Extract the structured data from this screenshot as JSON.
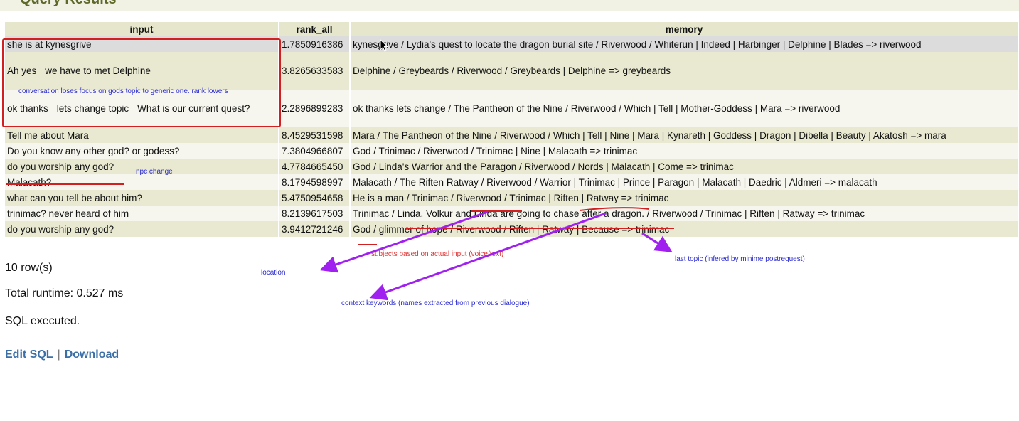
{
  "page": {
    "section_title": "Query Results"
  },
  "table": {
    "columns": [
      "input",
      "rank_all",
      "memory"
    ],
    "rows": [
      {
        "input_a": "she is at kynesgrive",
        "input_b": "",
        "input_c": "",
        "rank_all": "1.7850916386",
        "memory": "kynesgrive / Lydia's quest to locate the dragon burial site / Riverwood / Whiterun | Indeed | Harbinger | Delphine | Blades => riverwood"
      },
      {
        "input_a": "Ah yes",
        "input_b": "we have to met Delphine",
        "input_c": "",
        "rank_all": "3.8265633583",
        "memory": "Delphine / Greybeards / Riverwood / Greybeards | Delphine => greybeards"
      },
      {
        "input_a": "ok  thanks",
        "input_b": "lets change topic",
        "input_c": "What is our current quest?",
        "rank_all": "2.2896899283",
        "memory": "ok thanks lets change / The Pantheon of the Nine / Riverwood / Which | Tell | Mother-Goddess | Mara => riverwood"
      },
      {
        "input_a": "Tell me about Mara",
        "input_b": "",
        "input_c": "",
        "rank_all": "8.4529531598",
        "memory": "Mara / The Pantheon of the Nine / Riverwood / Which | Tell | Nine | Mara | Kynareth | Goddess | Dragon | Dibella | Beauty | Akatosh => mara"
      },
      {
        "input_a": "Do you know any other god? or godess?",
        "input_b": "",
        "input_c": "",
        "rank_all": "7.3804966807",
        "memory": "God / Trinimac / Riverwood / Trinimac | Nine | Malacath => trinimac"
      },
      {
        "input_a": "do you worship any god?",
        "input_b": "",
        "input_c": "",
        "rank_all": "4.7784665450",
        "memory": "God / Linda's Warrior and the Paragon / Riverwood / Nords | Malacath | Come => trinimac"
      },
      {
        "input_a": "Malacath?",
        "input_b": "",
        "input_c": "",
        "rank_all": "8.1794598997",
        "memory": "Malacath / The Riften Ratway / Riverwood / Warrior | Trinimac | Prince | Paragon | Malacath | Daedric | Aldmeri => malacath"
      },
      {
        "input_a": "what can you tell be about him?",
        "input_b": "",
        "input_c": "",
        "rank_all": "5.4750954658",
        "memory": "He is a man / Trinimac / Riverwood / Trinimac | Riften | Ratway => trinimac"
      },
      {
        "input_a": "trinimac? never heard of him",
        "input_b": "",
        "input_c": "",
        "rank_all": "8.2139617503",
        "memory": "Trinimac / Linda, Volkur and Linda are going to chase after a dragon. / Riverwood / Trinimac | Riften | Ratway => trinimac"
      },
      {
        "input_a": "do you worship any god?",
        "input_b": "",
        "input_c": "",
        "rank_all": "3.9412721246",
        "memory": "God / glimmer of hope / Riverwood / Riften | Ratway | Because => trinimac"
      }
    ]
  },
  "status": {
    "row_count": "10 row(s)",
    "runtime": "Total runtime: 0.527 ms",
    "executed": "SQL executed."
  },
  "links": {
    "edit_sql": "Edit SQL",
    "separator": "|",
    "download": "Download"
  },
  "annotations": {
    "focus_note": "conversation loses focus on gods topic to generic one. rank lowers",
    "npc_change": "npc change",
    "subjects": "subjects based on actual input (voice/text)",
    "last_topic": "last topic (infered by minime postrequest)",
    "location": "location",
    "context_keywords": "context keywords (names extracted from previous dialogue)"
  },
  "colors": {
    "header_bg": "#e6e6cc",
    "row_odd": "#e9e9d2",
    "row_even": "#f6f6ee",
    "row_highlight": "#dcdcdc",
    "link": "#3b6fa8",
    "annotation_box": "#d22020",
    "annotation_arrow": "#a020f0",
    "annotation_blue": "#2a2ad0",
    "annotation_red": "#e03030"
  }
}
